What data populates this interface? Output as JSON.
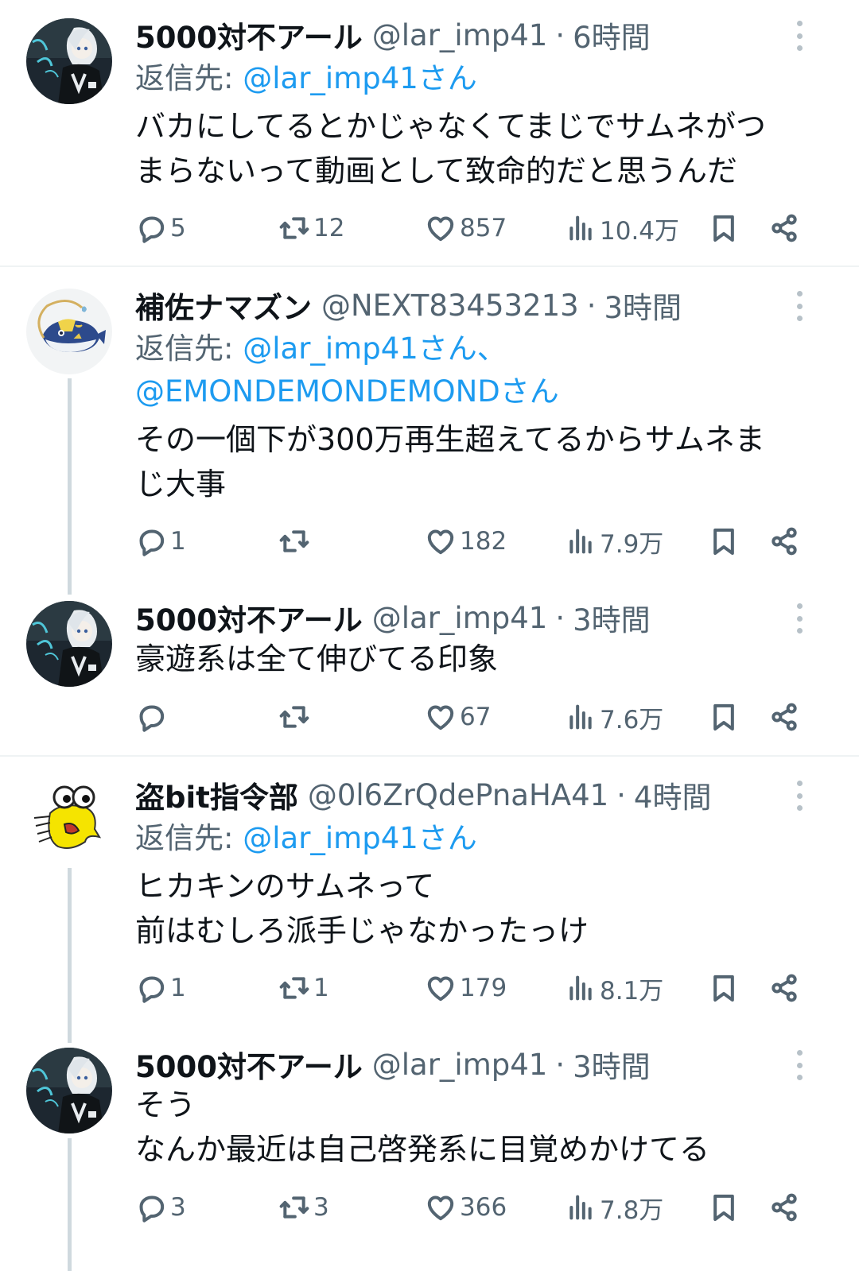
{
  "colors": {
    "text": "#0f1419",
    "secondary": "#536471",
    "link": "#1d9bf0",
    "thread": "#cfd9de",
    "divider": "#eff3f4"
  },
  "tweets": [
    {
      "name": "5000対不アール",
      "handle": "@lar_imp41",
      "sep": "·",
      "time": "6時間",
      "reply_prefix": "返信先:",
      "reply_to": "@lar_imp41さん",
      "reply_to_2": "",
      "lines": [
        "バカにしてるとかじゃなくてまじでサムネがつ",
        "まらないって動画として致命的だと思うんだ"
      ],
      "replies": "5",
      "retweets": "12",
      "likes": "857",
      "views": "10.4万",
      "avatar_icon": "anime-girl-avatar"
    },
    {
      "name": "補佐ナマズン",
      "handle": "@NEXT83453213",
      "sep": "·",
      "time": "3時間",
      "reply_prefix": "返信先:",
      "reply_to": "@lar_imp41さん、",
      "reply_to_2": "@EMONDEMONDEMONDさん",
      "lines": [
        "その一個下が300万再生超えてるからサムネま",
        "じ大事"
      ],
      "replies": "1",
      "retweets": "",
      "likes": "182",
      "views": "7.9万",
      "avatar_icon": "whiscash-avatar"
    },
    {
      "name": "5000対不アール",
      "handle": "@lar_imp41",
      "sep": "·",
      "time": "3時間",
      "reply_prefix": "",
      "reply_to": "",
      "reply_to_2": "",
      "lines": [
        "豪遊系は全て伸びてる印象"
      ],
      "replies": "",
      "retweets": "",
      "likes": "67",
      "views": "7.6万",
      "avatar_icon": "anime-girl-avatar"
    },
    {
      "name": "盗bit指令部",
      "handle": "@0l6ZrQdePnaHA41",
      "sep": "·",
      "time": "4時間",
      "reply_prefix": "返信先:",
      "reply_to": "@lar_imp41さん",
      "reply_to_2": "",
      "lines": [
        "ヒカキンのサムネって",
        "前はむしろ派手じゃなかったっけ"
      ],
      "replies": "1",
      "retweets": "1",
      "likes": "179",
      "views": "8.1万",
      "avatar_icon": "yellow-fish-avatar"
    },
    {
      "name": "5000対不アール",
      "handle": "@lar_imp41",
      "sep": "·",
      "time": "3時間",
      "reply_prefix": "",
      "reply_to": "",
      "reply_to_2": "",
      "lines": [
        "そう",
        "なんか最近は自己啓発系に目覚めかけてる"
      ],
      "replies": "3",
      "retweets": "3",
      "likes": "366",
      "views": "7.8万",
      "avatar_icon": "anime-girl-avatar"
    }
  ]
}
